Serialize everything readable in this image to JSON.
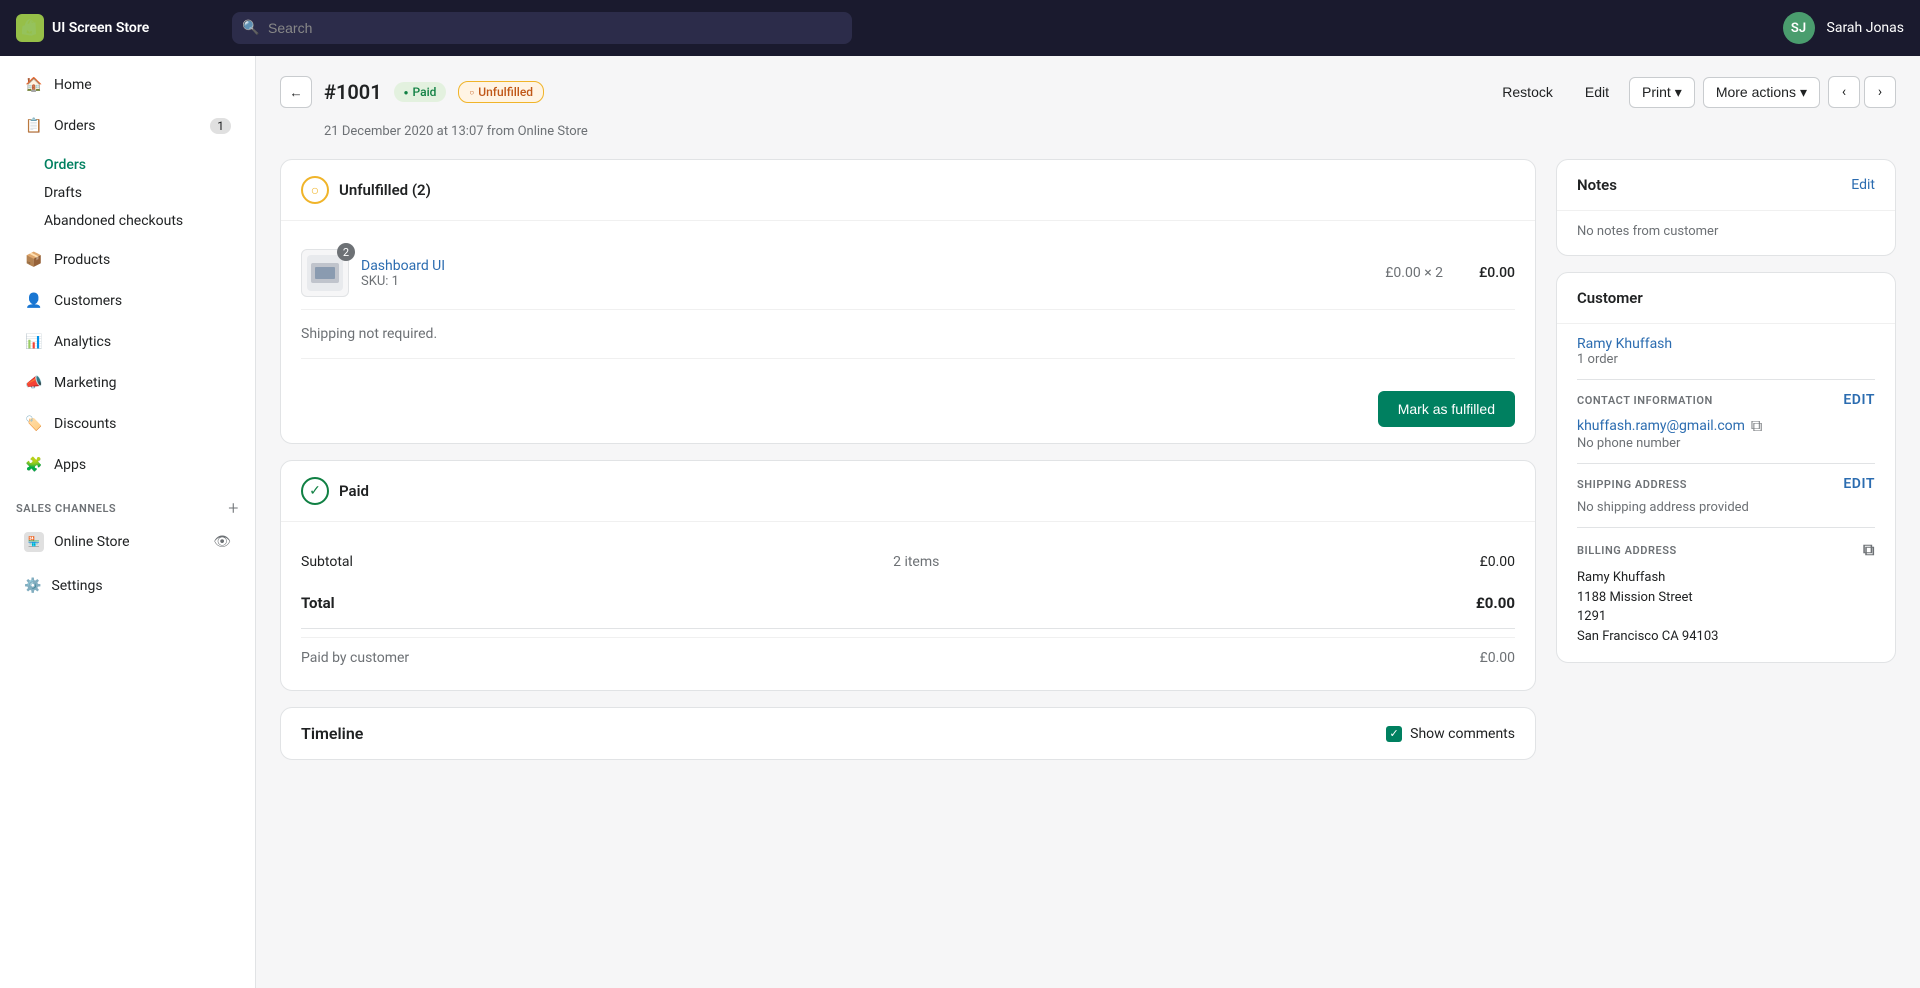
{
  "brand": {
    "logo_initials": "S",
    "store_name": "UI Screen Store"
  },
  "search": {
    "placeholder": "Search"
  },
  "user": {
    "initials": "SJ",
    "name": "Sarah Jonas"
  },
  "sidebar": {
    "home_label": "Home",
    "orders_label": "Orders",
    "orders_badge": "1",
    "orders_sub": [
      {
        "label": "Orders",
        "active": true
      },
      {
        "label": "Drafts",
        "active": false
      },
      {
        "label": "Abandoned checkouts",
        "active": false
      }
    ],
    "products_label": "Products",
    "customers_label": "Customers",
    "analytics_label": "Analytics",
    "marketing_label": "Marketing",
    "discounts_label": "Discounts",
    "apps_label": "Apps",
    "sales_channels_label": "SALES CHANNELS",
    "online_store_label": "Online Store",
    "settings_label": "Settings"
  },
  "header": {
    "back_label": "←",
    "order_number": "#1001",
    "badge_paid": "Paid",
    "badge_unfulfilled": "Unfulfilled",
    "subtitle": "21 December 2020 at 13:07 from Online Store",
    "restock_label": "Restock",
    "edit_label": "Edit",
    "print_label": "Print",
    "more_actions_label": "More actions"
  },
  "unfulfilled": {
    "title": "Unfulfilled (2)",
    "product_name": "Dashboard UI",
    "product_sku": "SKU: 1",
    "product_qty": "2",
    "product_unit_price": "£0.00",
    "product_multiplier": "× 2",
    "product_total": "£0.00",
    "shipping_note": "Shipping not required.",
    "mark_fulfilled_label": "Mark as fulfilled"
  },
  "payment": {
    "title": "Paid",
    "subtotal_label": "Subtotal",
    "subtotal_items": "2 items",
    "subtotal_amount": "£0.00",
    "total_label": "Total",
    "total_amount": "£0.00",
    "paid_by_label": "Paid by customer",
    "paid_by_amount": "£0.00"
  },
  "timeline": {
    "title": "Timeline",
    "show_comments_label": "Show comments"
  },
  "notes": {
    "title": "Notes",
    "edit_label": "Edit",
    "empty": "No notes from customer"
  },
  "customer": {
    "section_title": "Customer",
    "name": "Ramy Khuffash",
    "orders_count": "1 order",
    "contact_section": "CONTACT INFORMATION",
    "edit_contact_label": "Edit",
    "email": "khuffash.ramy@gmail.com",
    "no_phone": "No phone number",
    "shipping_section": "SHIPPING ADDRESS",
    "edit_shipping_label": "Edit",
    "no_shipping": "No shipping address provided",
    "billing_section": "BILLING ADDRESS",
    "billing_name": "Ramy Khuffash",
    "billing_street": "1188 Mission Street",
    "billing_apt": "1291",
    "billing_city": "San Francisco CA 94103"
  }
}
